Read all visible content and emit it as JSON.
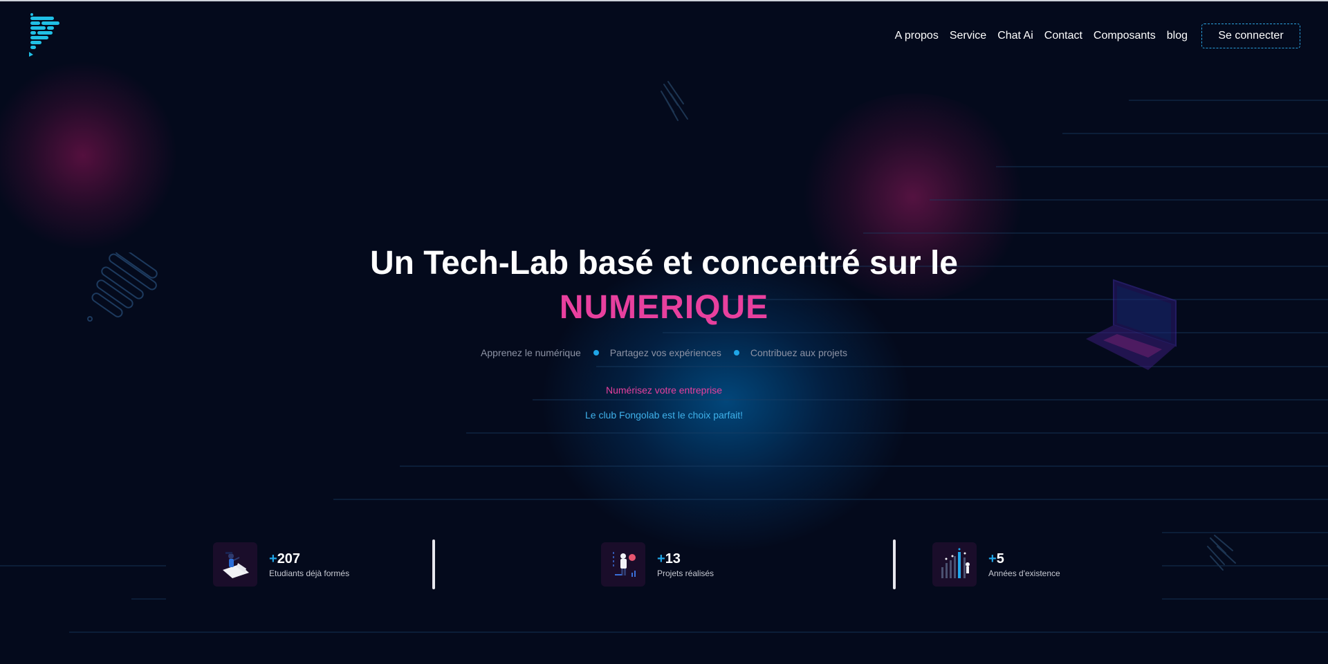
{
  "nav": {
    "links": [
      "A propos",
      "Service",
      "Chat Ai",
      "Contact",
      "Composants",
      "blog"
    ],
    "login_label": "Se connecter"
  },
  "hero": {
    "title": "Un Tech-Lab basé et concentré sur le",
    "highlight": "NUMERIQUE",
    "taglines": [
      "Apprenez le numérique",
      "Partagez vos expériences",
      "Contribuez aux projets"
    ],
    "cta_primary": "Numérisez votre entreprise",
    "cta_secondary": "Le club Fongolab est le choix parfait!"
  },
  "stats": [
    {
      "plus": "+",
      "value": "207",
      "label": "Etudiants déjà formés",
      "icon": "student-graduation-icon"
    },
    {
      "plus": "+",
      "value": "13",
      "label": "Projets réalisés",
      "icon": "project-presentation-icon"
    },
    {
      "plus": "+",
      "value": "5",
      "label": "Années d'existence",
      "icon": "growth-chart-icon"
    }
  ],
  "colors": {
    "background": "#040a1c",
    "accent_pink": "#e8409e",
    "accent_blue": "#1fa6e8"
  }
}
